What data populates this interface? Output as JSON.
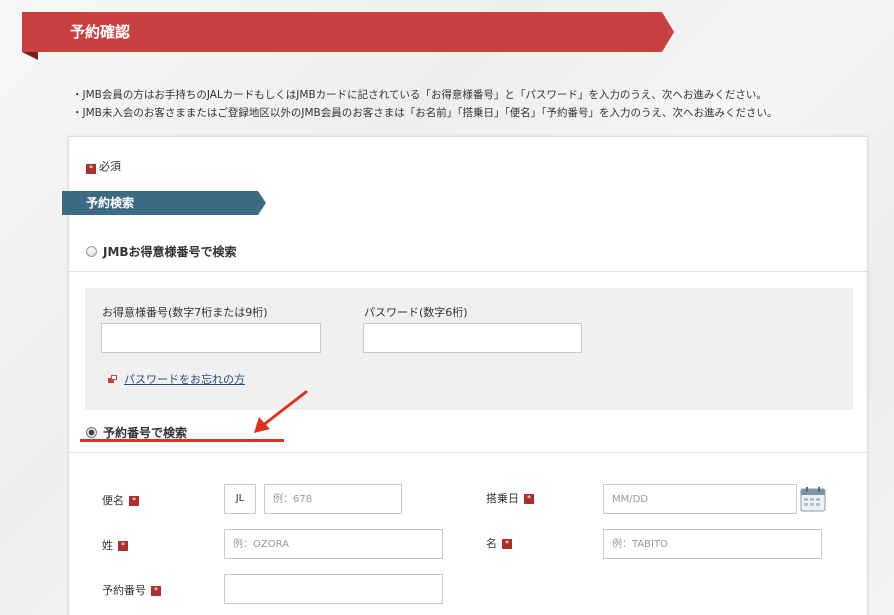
{
  "page": {
    "title": "予約確認"
  },
  "notes": [
    "・JMB会員の方はお手持ちのJALカードもしくはJMBカードに記されている「お得意様番号」と「パスワード」を入力のうえ、次へお進みください。",
    "・JMB未入会のお客さままたはご登録地区以外のJMB会員のお客さまは「お名前」「搭乗日」「便名」「予約番号」を入力のうえ、次へお進みください。"
  ],
  "required_note": {
    "mark": "*",
    "text": "必須"
  },
  "section": {
    "title": "予約検索"
  },
  "jmb_search": {
    "radio_label": "JMBお得意様番号で検索",
    "selected": false,
    "member_number": {
      "label": "お得意様番号(数字7桁または9桁)",
      "value": "",
      "placeholder": ""
    },
    "password": {
      "label": "パスワード(数字6桁)",
      "value": "",
      "placeholder": ""
    },
    "forgot_link": "パスワードをお忘れの方"
  },
  "reservation_search": {
    "radio_label": "予約番号で検索",
    "selected": true,
    "flight": {
      "label": "便名",
      "prefix": "JL",
      "placeholder": "例：678",
      "value": ""
    },
    "boarding_date": {
      "label": "搭乗日",
      "placeholder": "MM/DD",
      "value": ""
    },
    "last_name": {
      "label": "姓",
      "placeholder": "例：OZORA",
      "value": ""
    },
    "first_name": {
      "label": "名",
      "placeholder": "例：TABITO",
      "value": ""
    },
    "reservation_number": {
      "label": "予約番号",
      "placeholder": "",
      "value": ""
    }
  },
  "icons": {
    "calendar": "calendar-icon",
    "link": "link-icon",
    "required": "required-icon"
  },
  "colors": {
    "title_bg": "#c6413f",
    "section_bg": "#3c6a83",
    "required": "#a8302d",
    "annotation": "#e0311f",
    "link": "#2a4f7c"
  }
}
